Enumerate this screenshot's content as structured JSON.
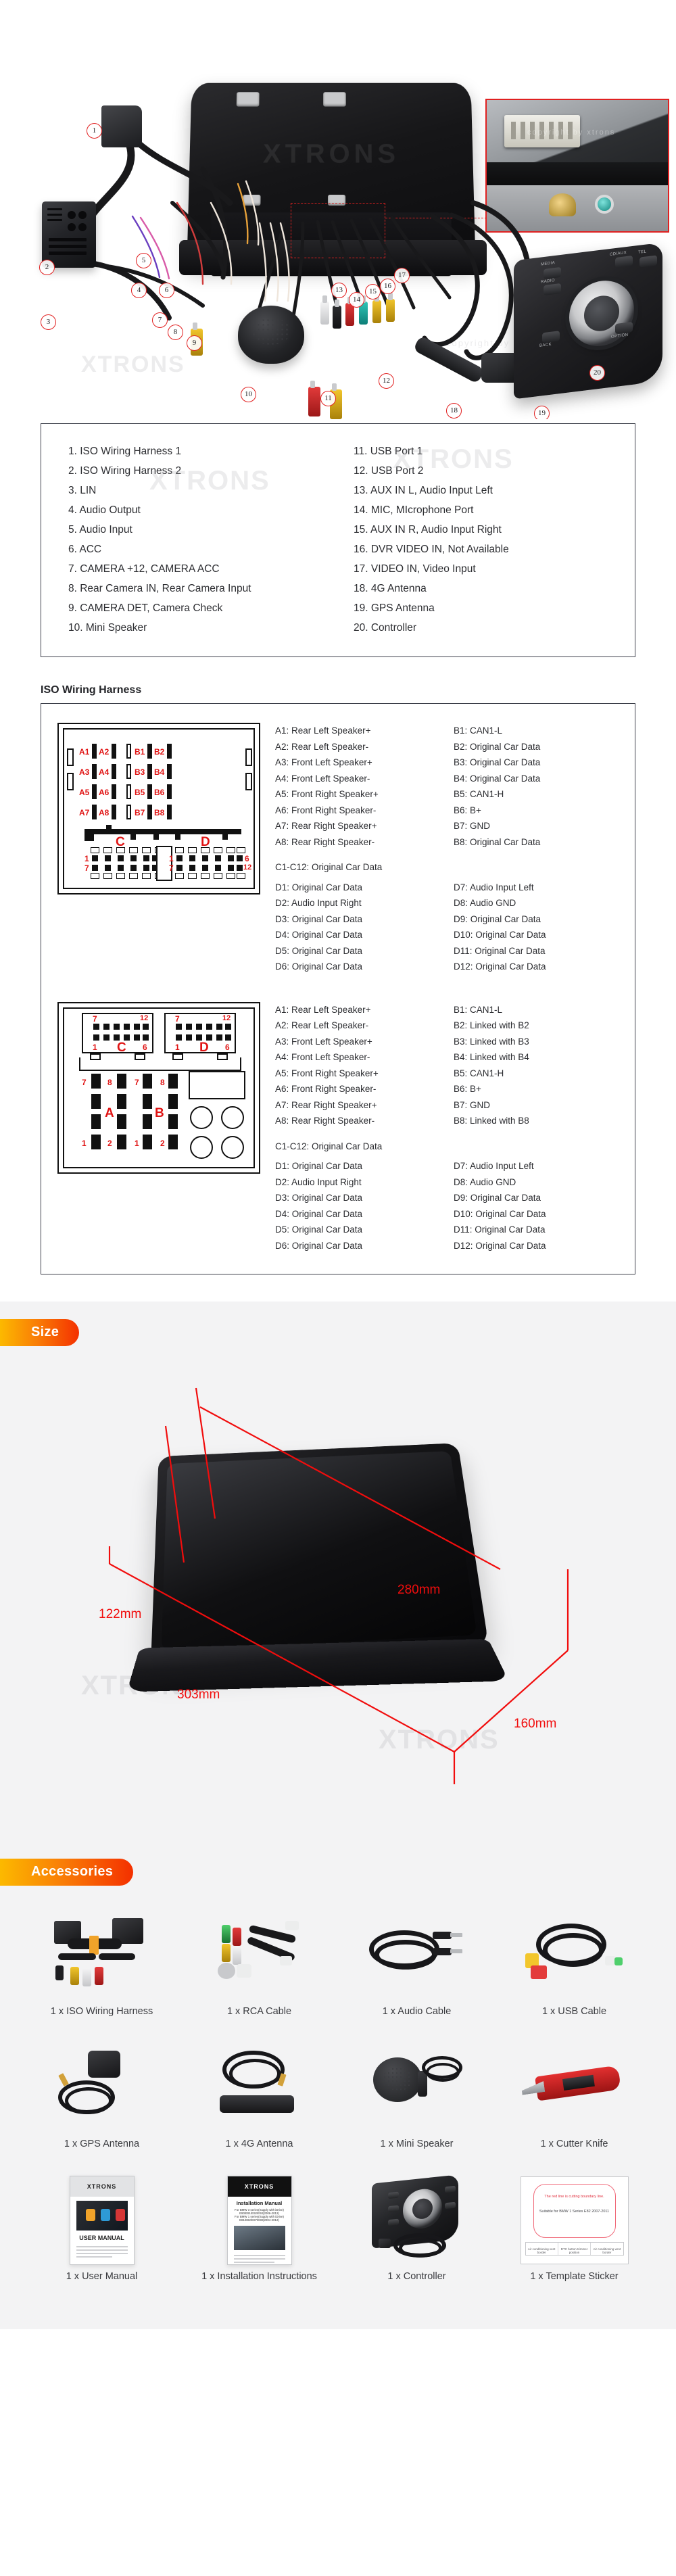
{
  "brand_watermark": "XTRONS",
  "copyright_watermark": "copyright by xtrons",
  "hero": {
    "callouts": [
      "1",
      "2",
      "3",
      "4",
      "5",
      "6",
      "7",
      "8",
      "9",
      "10",
      "11",
      "12",
      "13",
      "14",
      "15",
      "16",
      "17",
      "18",
      "19",
      "20"
    ],
    "controller_buttons": [
      "MEDIA",
      "CD/AUX",
      "TEL",
      "RADIO",
      "BACK",
      "OPTION"
    ]
  },
  "parts_list": {
    "left": [
      "1. ISO Wiring Harness 1",
      "2. ISO Wiring Harness 2",
      "3. LIN",
      "4. Audio Output",
      "5. Audio Input",
      "6. ACC",
      "7. CAMERA +12, CAMERA ACC",
      "8. Rear Camera IN, Rear Camera Input",
      "9. CAMERA DET, Camera Check",
      "10. Mini Speaker"
    ],
    "right": [
      "11. USB Port 1",
      "12. USB Port 2",
      "13. AUX IN L, Audio Input Left",
      "14. MIC, MIcrophone Port",
      "15. AUX IN R, Audio Input Right",
      "16. DVR VIDEO IN, Not Available",
      "17. VIDEO IN, Video Input",
      "18. 4G Antenna",
      "19. GPS Antenna",
      "20. Controller"
    ]
  },
  "iso_section": {
    "title": "ISO Wiring Harness",
    "harness1": {
      "diagram_labels": {
        "blades": [
          "A1",
          "A2",
          "B1",
          "B2",
          "A3",
          "A4",
          "B3",
          "B4",
          "A5",
          "A6",
          "B5",
          "B6",
          "A7",
          "A8",
          "B7",
          "B8"
        ],
        "groups": [
          "C",
          "D"
        ],
        "pin_numbers": [
          "1",
          "6",
          "7",
          "12",
          "1",
          "6",
          "7",
          "12"
        ]
      },
      "a_col": [
        "A1: Rear Left Speaker+",
        "A2: Rear Left Speaker-",
        "A3: Front Left Speaker+",
        "A4: Front Left Speaker-",
        "A5: Front Right Speaker+",
        "A6: Front Right Speaker-",
        "A7: Rear Right Speaker+",
        "A8: Rear Right Speaker-"
      ],
      "b_col": [
        "B1: CAN1-L",
        "B2: Original Car Data",
        "B3: Original Car Data",
        "B4: Original Car Data",
        "B5: CAN1-H",
        "B6: B+",
        "B7: GND",
        "B8: Original Car Data"
      ],
      "c_note": "C1-C12: Original Car Data",
      "d_left": [
        "D1: Original Car Data",
        "D2: Audio Input Right",
        "D3: Original Car Data",
        "D4: Original Car Data",
        "D5: Original Car Data",
        "D6: Original Car Data"
      ],
      "d_right": [
        "D7: Audio Input Left",
        "D8: Audio GND",
        "D9: Original Car Data",
        "D10: Original Car Data",
        "D11: Original Car Data",
        "D12: Original Car Data"
      ]
    },
    "harness2": {
      "diagram_labels": {
        "groups": [
          "C",
          "D",
          "A",
          "B"
        ],
        "pin_numbers": [
          "7",
          "12",
          "1",
          "6",
          "7",
          "12",
          "1",
          "6",
          "7",
          "8",
          "7",
          "8",
          "1",
          "2",
          "1",
          "2"
        ]
      },
      "a_col": [
        "A1: Rear Left Speaker+",
        "A2: Rear Left Speaker-",
        "A3: Front Left Speaker+",
        "A4: Front Left Speaker-",
        "A5: Front Right Speaker+",
        "A6: Front Right Speaker-",
        "A7: Rear Right Speaker+",
        "A8: Rear Right Speaker-"
      ],
      "b_col": [
        "B1: CAN1-L",
        "B2: Linked with B2",
        "B3: Linked with B3",
        "B4: Linked with B4",
        "B5: CAN1-H",
        "B6: B+",
        "B7: GND",
        "B8: Linked with B8"
      ],
      "c_note": "C1-C12: Original Car Data",
      "d_left": [
        "D1: Original Car Data",
        "D2: Audio Input Right",
        "D3: Original Car Data",
        "D4: Original Car Data",
        "D5: Original Car Data",
        "D6: Original Car Data"
      ],
      "d_right": [
        "D7: Audio Input Left",
        "D8: Audio GND",
        "D9: Original Car Data",
        "D10: Original Car Data",
        "D11: Original Car Data",
        "D12: Original Car Data"
      ]
    }
  },
  "size_section": {
    "badge": "Size",
    "dimensions": {
      "height": "122mm",
      "width_top": "280mm",
      "width_base": "303mm",
      "depth": "160mm"
    }
  },
  "accessories_section": {
    "badge": "Accessories",
    "items": [
      {
        "label": "1 x ISO Wiring Harness",
        "icon": "iso-harness-icon"
      },
      {
        "label": "1 x RCA Cable",
        "icon": "rca-cable-icon"
      },
      {
        "label": "1 x Audio Cable",
        "icon": "audio-cable-icon"
      },
      {
        "label": "1 x USB Cable",
        "icon": "usb-cable-icon"
      },
      {
        "label": "1 x GPS Antenna",
        "icon": "gps-antenna-icon"
      },
      {
        "label": "1 x 4G Antenna",
        "icon": "4g-antenna-icon"
      },
      {
        "label": "1 x Mini Speaker",
        "icon": "mini-speaker-icon"
      },
      {
        "label": "1 x Cutter Knife",
        "icon": "cutter-knife-icon"
      },
      {
        "label": "1 x User Manual",
        "icon": "user-manual-icon"
      },
      {
        "label": "1 x Installation Instructions",
        "icon": "installation-instructions-icon"
      },
      {
        "label": "1 x Controller",
        "icon": "controller-icon"
      },
      {
        "label": "1 x Template Sticker",
        "icon": "template-sticker-icon"
      }
    ],
    "user_manual_cover": {
      "brand": "XTRONS",
      "title": "USER MANUAL"
    },
    "install_cover": {
      "brand": "XTRONS",
      "title": "Installation Manual",
      "line1": "For BMW 3 series(Supply with iDrive)",
      "line2": "E90/E91/E92/E93(2006-2012)",
      "line3": "For BMW 1 series(Supply with iDrive)",
      "line4": "E81/E82/E87/E88(2004-2012)"
    },
    "template_texts": {
      "red_note": "The red line is cutting boundary line.",
      "fit_note": "Suitable for BMW 1 Series E82 2007-2011",
      "cells": [
        "Air conditioning vent border",
        "DTC button trimmer position",
        "Air conditioning vent border"
      ]
    }
  },
  "colors": {
    "accent_red": "#e12020",
    "badge_from": "#fcb900",
    "badge_to": "#f43000",
    "dim_red": "#f10d0d",
    "border": "#3c3f4a",
    "band_bg": "#f3f3f4"
  }
}
